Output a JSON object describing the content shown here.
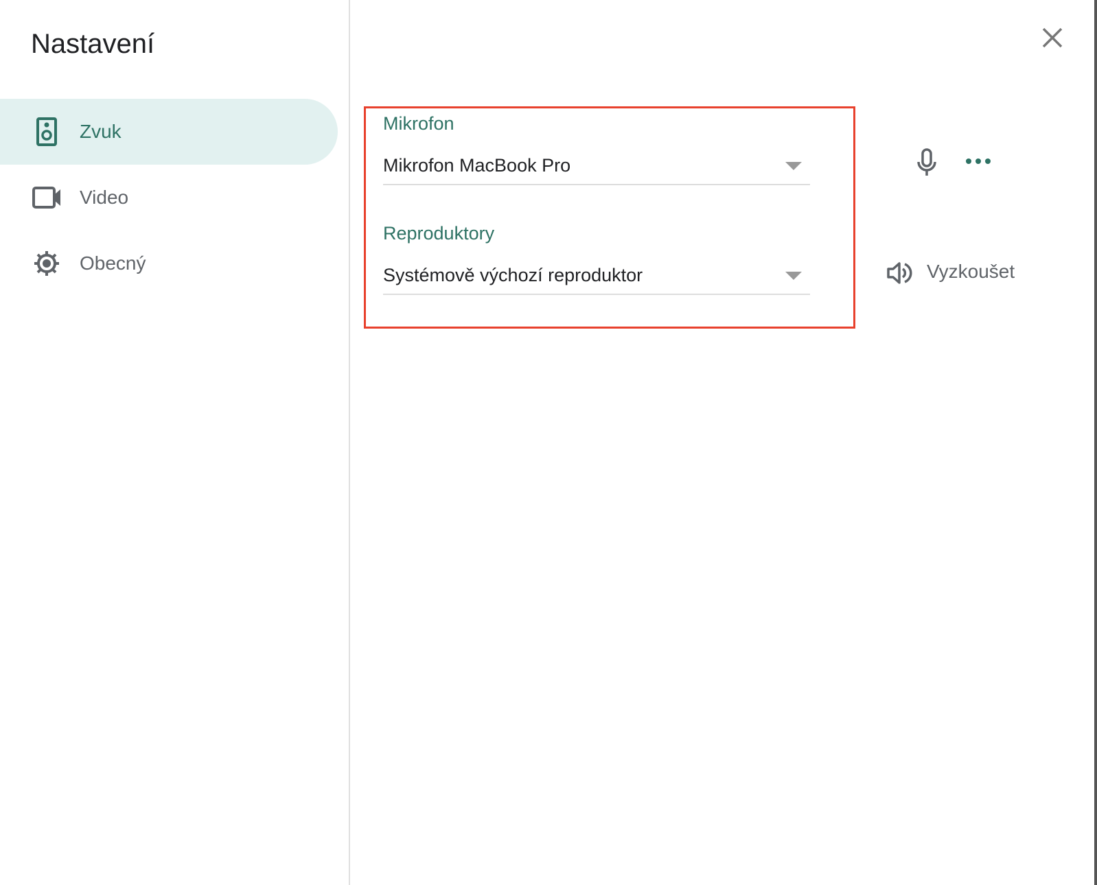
{
  "title": "Nastavení",
  "sidebar": {
    "items": [
      {
        "label": "Zvuk",
        "icon": "speaker-icon",
        "active": true
      },
      {
        "label": "Video",
        "icon": "videocam-icon",
        "active": false
      },
      {
        "label": "Obecný",
        "icon": "gear-icon",
        "active": false
      }
    ]
  },
  "audio": {
    "microphone_label": "Mikrofon",
    "microphone_value": "Mikrofon MacBook Pro",
    "speakers_label": "Reproduktory",
    "speakers_value": "Systémově výchozí reproduktor",
    "test_label": "Vyzkoušet"
  },
  "colors": {
    "accent": "#2e7264",
    "highlight": "#e8412d",
    "active_bg": "#e2f1f0"
  }
}
